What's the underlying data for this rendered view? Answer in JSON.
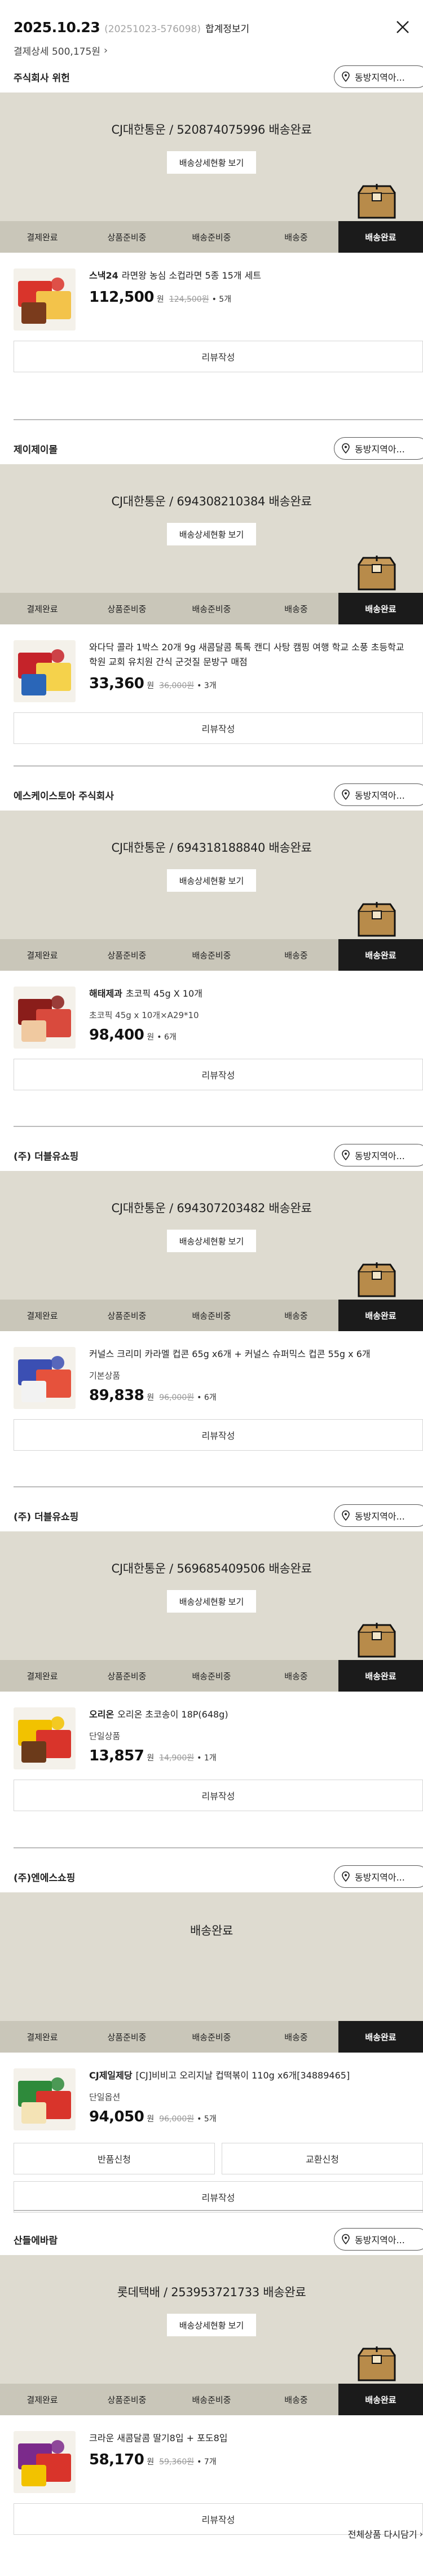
{
  "header": {
    "date": "2025.10.23",
    "order_no": "(20251023-576098)",
    "package_link": "합계정보기",
    "payment_detail": "결제상세 500,175원"
  },
  "neighbor_label": "동방지역아...",
  "review_label": "리뷰작성",
  "detail_label": "배송상세현황 보기",
  "steps": [
    "결제완료",
    "상품준비중",
    "배송준비중",
    "배송중",
    "배송완료"
  ],
  "groups": [
    {
      "seller": "주식회사 위헌",
      "tracking": "CJ대한통운 / 520874075996 배송완료",
      "show_detail": true,
      "items": [
        {
          "brand": "스낵24",
          "name": "라면왕 농심 소컵라면 5종 15개 세트",
          "option": "",
          "price": "112,500",
          "won": "원",
          "orig": "124,500원",
          "qty": "• 5개"
        }
      ]
    },
    {
      "seller": "제이제이몰",
      "tracking": "CJ대한통운 / 694308210384 배송완료",
      "show_detail": true,
      "items": [
        {
          "brand": "",
          "name": "와다닥 콜라 1박스 20개 9g 새콤달콤 톡톡 캔디 사탕 캠핑 여행 학교 소풍 초등학교 학원 교회 유치원 간식 군것질 문방구 매점",
          "option": "",
          "price": "33,360",
          "won": "원",
          "orig": "36,000원",
          "qty": "• 3개"
        }
      ]
    },
    {
      "seller": "에스케이스토아 주식회사",
      "tracking": "CJ대한통운 / 694318188840 배송완료",
      "show_detail": true,
      "items": [
        {
          "brand": "해태제과",
          "name": "초코픽 45g X 10개",
          "option": "초코픽 45g x 10개×A29*10",
          "price": "98,400",
          "won": "원",
          "orig": "",
          "qty": "• 6개"
        }
      ]
    },
    {
      "seller": "(주) 더블유쇼핑",
      "tracking": "CJ대한통운 / 694307203482 배송완료",
      "show_detail": true,
      "items": [
        {
          "brand": "",
          "name": "커널스 크리미 카라멜 컵콘 65g x6개 + 커널스 슈퍼믹스 컵콘 55g x 6개",
          "option": "기본상품",
          "price": "89,838",
          "won": "원",
          "orig": "96,000원",
          "qty": "• 6개"
        }
      ]
    },
    {
      "seller": "(주) 더블유쇼핑",
      "tracking": "CJ대한통운 / 569685409506 배송완료",
      "show_detail": true,
      "items": [
        {
          "brand": "오리온",
          "name": "오리온 초코송이 18P(648g)",
          "option": "단일상품",
          "price": "13,857",
          "won": "원",
          "orig": "14,900원",
          "qty": "• 1개"
        }
      ]
    },
    {
      "seller": "(주)엔에스쇼핑",
      "tracking": "배송완료",
      "show_detail": false,
      "items": [
        {
          "brand": "CJ제일제당",
          "name": "[CJ]비비고 오리지날 컵떡볶이 110g x6개[34889465]",
          "option": "단일옵션",
          "price": "94,050",
          "won": "원",
          "orig": "96,000원",
          "qty": "• 5개"
        }
      ],
      "extra_buttons": [
        "반품신청",
        "교환신청"
      ]
    },
    {
      "seller": "산들에바람",
      "tracking": "롯데택배 / 253953721733 배송완료",
      "show_detail": true,
      "items": [
        {
          "brand": "",
          "name": "크라운 새콤달콤 딸기8입 + 포도8입",
          "option": "",
          "price": "58,170",
          "won": "원",
          "orig": "59,360원",
          "qty": "• 7개"
        }
      ]
    }
  ],
  "bottom_link": "전체상품 다시담기",
  "colors": {
    "track_bg": "#dedbd0",
    "stepper_bg": "#c9c6b9",
    "active_step": "#1b1b1b"
  }
}
